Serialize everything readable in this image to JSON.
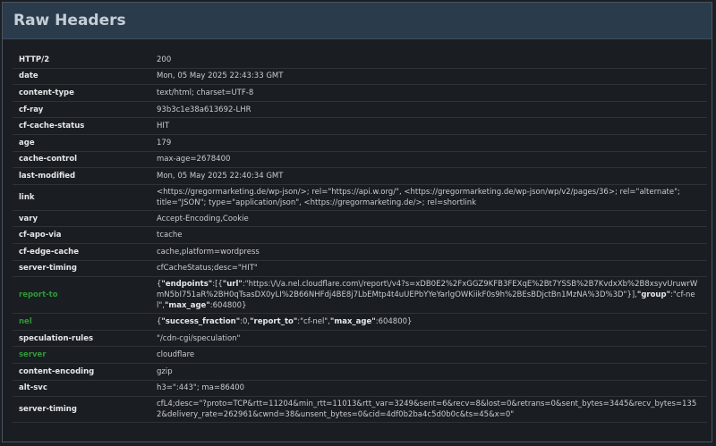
{
  "panel": {
    "title": "Raw Headers"
  },
  "headers": [
    {
      "name": "HTTP/2",
      "value": "200"
    },
    {
      "name": "date",
      "value": "Mon, 05 May 2025 22:43:33 GMT"
    },
    {
      "name": "content-type",
      "value": "text/html; charset=UTF-8"
    },
    {
      "name": "cf-ray",
      "value": "93b3c1e38a613692-LHR"
    },
    {
      "name": "cf-cache-status",
      "value": "HIT"
    },
    {
      "name": "age",
      "value": "179"
    },
    {
      "name": "cache-control",
      "value": "max-age=2678400"
    },
    {
      "name": "last-modified",
      "value": "Mon, 05 May 2025 22:40:34 GMT"
    },
    {
      "name": "link",
      "value": "<https://gregormarketing.de/wp-json/>; rel=\"https://api.w.org/\", <https://gregormarketing.de/wp-json/wp/v2/pages/36>; rel=\"alternate\"; title=\"JSON\"; type=\"application/json\", <https://gregormarketing.de/>; rel=shortlink"
    },
    {
      "name": "vary",
      "value": "Accept-Encoding,Cookie"
    },
    {
      "name": "cf-apo-via",
      "value": "tcache"
    },
    {
      "name": "cf-edge-cache",
      "value": "cache,platform=wordpress"
    },
    {
      "name": "server-timing",
      "value": "cfCacheStatus;desc=\"HIT\""
    },
    {
      "name": "report-to",
      "highlight": true,
      "json_parts": [
        {
          "t": "{"
        },
        {
          "t": "\"endpoints\"",
          "key": true
        },
        {
          "t": ":[{"
        },
        {
          "t": "\"url\"",
          "key": true
        },
        {
          "t": ":\"https:\\/\\/a.nel.cloudflare.com\\/report\\/v4?s=xDB0E2%2FxGGZ9KFB3FEXqE%2Bt7YSSB%2B7KvdxXb%2B8xsyvUruwrWmN5bI751aR%2BH0qTsasDX0yLI%2B66NHFdj4BE8j7LbEMtp4t4uUEPbYYeYarlgOWKiikF0s9h%2BEsBDjctBn1MzNA%3D%3D\"}],"
        },
        {
          "t": "\"group\"",
          "key": true
        },
        {
          "t": ":\"cf-nel\","
        },
        {
          "t": "\"max_age\"",
          "key": true
        },
        {
          "t": ":604800}"
        }
      ]
    },
    {
      "name": "nel",
      "highlight": true,
      "json_parts": [
        {
          "t": "{"
        },
        {
          "t": "\"success_fraction\"",
          "key": true
        },
        {
          "t": ":0,"
        },
        {
          "t": "\"report_to\"",
          "key": true
        },
        {
          "t": ":\"cf-nel\","
        },
        {
          "t": "\"max_age\"",
          "key": true
        },
        {
          "t": ":604800}"
        }
      ]
    },
    {
      "name": "speculation-rules",
      "value": "\"/cdn-cgi/speculation\""
    },
    {
      "name": "server",
      "value": "cloudflare",
      "highlight": true
    },
    {
      "name": "content-encoding",
      "value": "gzip"
    },
    {
      "name": "alt-svc",
      "value": "h3=\":443\"; ma=86400"
    },
    {
      "name": "server-timing",
      "value": "cfL4;desc=\"?proto=TCP&rtt=11204&min_rtt=11013&rtt_var=3249&sent=6&recv=8&lost=0&retrans=0&sent_bytes=3445&recv_bytes=1352&delivery_rate=262961&cwnd=38&unsent_bytes=0&cid=4df0b2ba4c5d0b0c&ts=45&x=0\""
    }
  ]
}
